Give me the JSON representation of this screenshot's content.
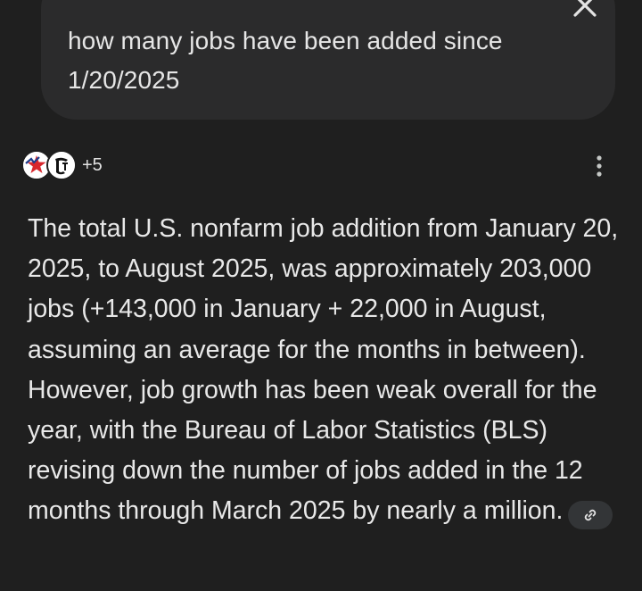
{
  "query": {
    "text": "how many jobs have been added since 1/20/2025"
  },
  "sources": {
    "icons": [
      "star-logo-icon",
      "newspaper-logo-icon"
    ],
    "more_count": "+5"
  },
  "answer": {
    "text": "The total U.S. nonfarm job addition from January 20, 2025, to August 2025, was approximately 203,000 jobs (+143,000 in January + 22,000 in August, assuming an average for the months in between). However, job growth has been weak overall for the year, with the Bureau of Labor Statistics (BLS) revising down the number of jobs added in the 12 months through March 2025 by nearly a million."
  },
  "colors": {
    "background": "#1f1f1f",
    "bubble": "#2b2b2c",
    "text": "#e8e8e8",
    "chip": "#333537"
  }
}
